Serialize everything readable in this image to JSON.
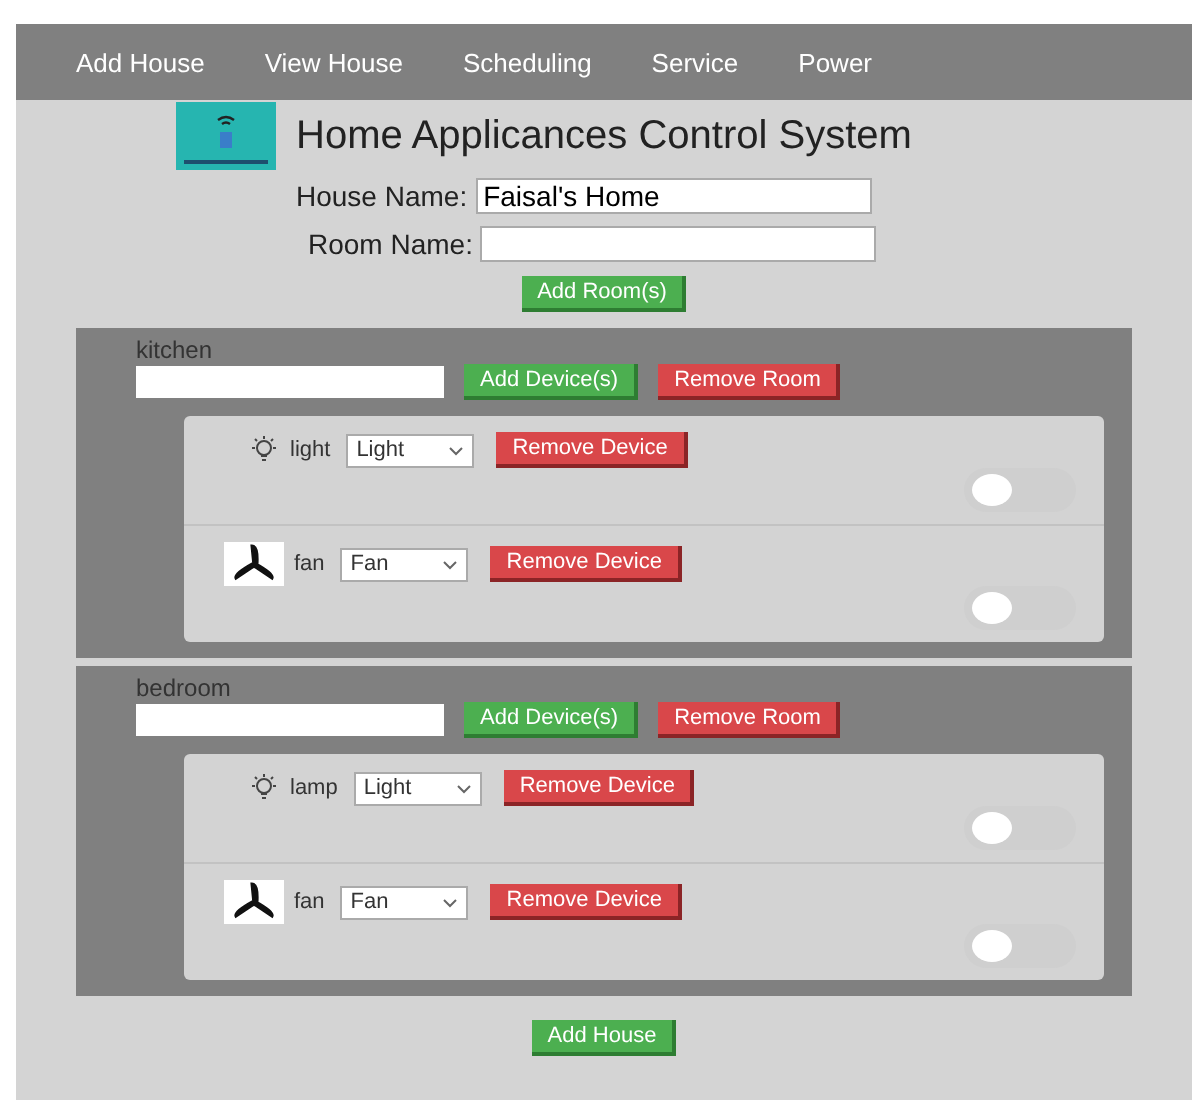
{
  "nav": [
    "Add House",
    "View House",
    "Scheduling",
    "Service",
    "Power"
  ],
  "title": "Home Applicances Control System",
  "house_name": {
    "label": "House Name:",
    "value": "Faisal's Home"
  },
  "room_name": {
    "label": "Room Name:"
  },
  "add_room_button": "Add Room(s)",
  "rooms": [
    {
      "name": "kitchen",
      "add_device_button": "Add Device(s)",
      "remove_room_button": "Remove Room",
      "devices": [
        {
          "kind": "light",
          "name": "light",
          "type": "Light",
          "remove_button": "Remove Device",
          "on": false
        },
        {
          "kind": "fan",
          "name": "fan",
          "type": "Fan",
          "remove_button": "Remove Device",
          "on": false
        }
      ]
    },
    {
      "name": "bedroom",
      "add_device_button": "Add Device(s)",
      "remove_room_button": "Remove Room",
      "devices": [
        {
          "kind": "light",
          "name": "lamp",
          "type": "Light",
          "remove_button": "Remove Device",
          "on": false
        },
        {
          "kind": "fan",
          "name": "fan",
          "type": "Fan",
          "remove_button": "Remove Device",
          "on": false
        }
      ]
    }
  ],
  "add_house_button": "Add House"
}
